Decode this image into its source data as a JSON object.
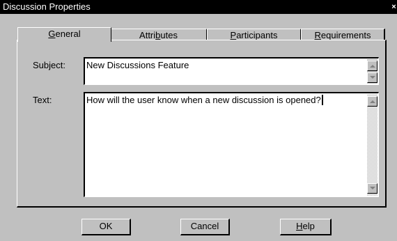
{
  "window": {
    "title": "Discussion Properties",
    "close_glyph": "×"
  },
  "tabs": [
    {
      "label": "General",
      "mnemonic": "G",
      "rest": "eneral",
      "selected": true
    },
    {
      "label": "Attributes",
      "pre": "Attri",
      "mnemonic": "b",
      "rest": "utes",
      "selected": false
    },
    {
      "label": "Participants",
      "mnemonic": "P",
      "rest": "articipants",
      "selected": false
    },
    {
      "label": "Requirements",
      "mnemonic": "R",
      "rest": "equirements",
      "selected": false
    }
  ],
  "form": {
    "subject_label": "Subject:",
    "subject_value": "New Discussions Feature",
    "text_label": "Text:",
    "text_value": "How will the user know when a new discussion is opened?"
  },
  "buttons": {
    "ok_label": "OK",
    "cancel_label": "Cancel",
    "help": {
      "label": "Help",
      "mnemonic": "H",
      "rest": "elp"
    }
  },
  "icons": {
    "scroll_up": "scroll-up-arrow",
    "scroll_down": "scroll-down-arrow",
    "close": "close-x"
  }
}
